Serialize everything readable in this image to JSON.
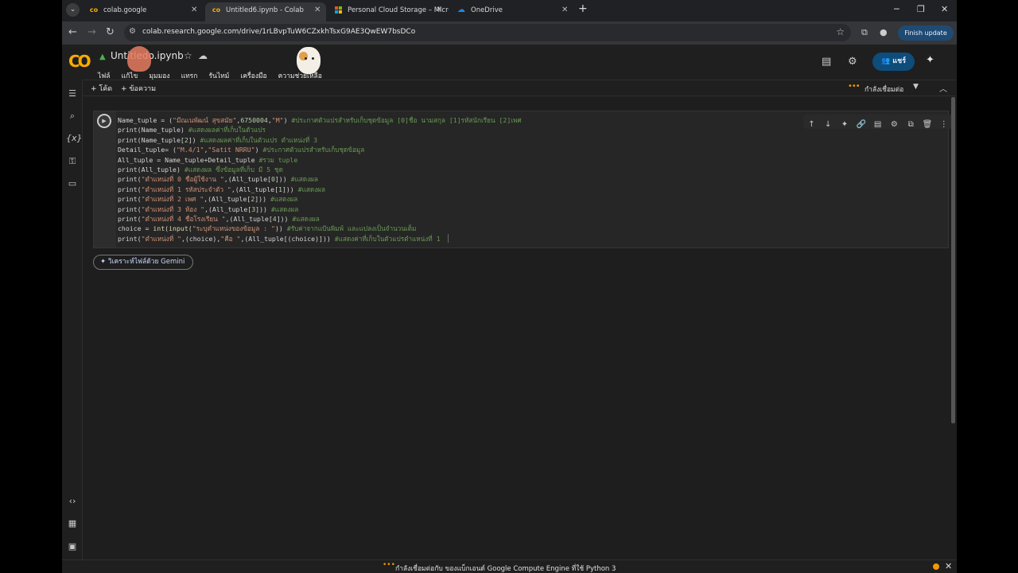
{
  "browser": {
    "tabs": [
      {
        "title": "colab.google",
        "icon": "colab-logo-icon"
      },
      {
        "title": "Untitled6.ipynb - Colab",
        "icon": "colab-logo-icon"
      },
      {
        "title": "Personal Cloud Storage – Micro",
        "icon": "microsoft-logo-icon"
      },
      {
        "title": "OneDrive",
        "icon": "onedrive-cloud-icon"
      }
    ],
    "active_tab": 1,
    "url": "colab.research.google.com/drive/1rLBvpTuW6CZxkhTsxG9AE3QwEW7bsDCo",
    "finish_update_label": "Finish update"
  },
  "colab": {
    "notebook_title": "Untitledo.ipynb",
    "menu": [
      "ไฟล์",
      "แก้ไข",
      "มุมมอง",
      "แทรก",
      "รันไทม์",
      "เครื่องมือ",
      "ความช่วยเหลือ"
    ],
    "share_label": "แชร์",
    "add_code_label": "+ โค้ด",
    "add_text_label": "+ ข้อความ",
    "connection_status": "กำลังเชื่อมต่อ",
    "gemini_analyze_label": "วิเคราะห์ไฟล์ด้วย Gemini",
    "status_bar_text": "กำลังเชื่อมต่อกับ ของแบ็กเอนด์ Google Compute Engine ที่ใช้ Python 3",
    "accent_color": "#f9ab00"
  },
  "code_lines": [
    [
      {
        "t": "Name_tuple = (",
        "c": "kw"
      },
      {
        "t": "\"มีณเนพัฒน์ สุขสมัย\"",
        "c": "str"
      },
      {
        "t": ",",
        "c": "kw"
      },
      {
        "t": "6750004",
        "c": "num"
      },
      {
        "t": ",",
        "c": "kw"
      },
      {
        "t": "\"M\"",
        "c": "str"
      },
      {
        "t": ") ",
        "c": "kw"
      },
      {
        "t": "#ประกาศตัวแปรสำหรับเก็บชุดข้อมูล [0]ชื่อ นามสกุล [1]รหัสนักเรียน [2]เพศ",
        "c": "com"
      }
    ],
    [
      {
        "t": "print",
        "c": "kw"
      },
      {
        "t": "(Name_tuple) ",
        "c": "kw"
      },
      {
        "t": "#แสดงผลค่าที่เก็บในตัวแปร",
        "c": "com"
      }
    ],
    [
      {
        "t": "print",
        "c": "kw"
      },
      {
        "t": "(Name_tuple[",
        "c": "kw"
      },
      {
        "t": "2",
        "c": "num"
      },
      {
        "t": "]) ",
        "c": "kw"
      },
      {
        "t": "#แสดงผลค่าที่เก็บในตัวแปร ตำแหน่งที่ 3",
        "c": "com"
      }
    ],
    [
      {
        "t": "Detail_tuple= (",
        "c": "kw"
      },
      {
        "t": "\"M.4/1\"",
        "c": "str"
      },
      {
        "t": ",",
        "c": "kw"
      },
      {
        "t": "\"Satit NRRU\"",
        "c": "str"
      },
      {
        "t": ") ",
        "c": "kw"
      },
      {
        "t": "#ประกาศตัวแปรสำหรับเก็บชุดข้อมูล",
        "c": "com"
      }
    ],
    [
      {
        "t": "All_tuple = Name_tuple+Detail_tuple ",
        "c": "kw"
      },
      {
        "t": "#รวม tuple",
        "c": "com"
      }
    ],
    [
      {
        "t": "print",
        "c": "kw"
      },
      {
        "t": "(All_tuple) ",
        "c": "kw"
      },
      {
        "t": "#แสดงผล ซึ่งข้อมูลที่เก็บ มี 5 ชุด",
        "c": "com"
      }
    ],
    [
      {
        "t": "print",
        "c": "kw"
      },
      {
        "t": "(",
        "c": "kw"
      },
      {
        "t": "\"ตำแหน่งที่ 0 ชื่อผู้ใช้งาน \"",
        "c": "str"
      },
      {
        "t": ",(All_tuple[",
        "c": "kw"
      },
      {
        "t": "0",
        "c": "num"
      },
      {
        "t": "])) ",
        "c": "kw"
      },
      {
        "t": "#แสดงผล",
        "c": "com"
      }
    ],
    [
      {
        "t": "print",
        "c": "kw"
      },
      {
        "t": "(",
        "c": "kw"
      },
      {
        "t": "\"ตำแหน่งที่ 1 รหัสประจำตัว \"",
        "c": "str"
      },
      {
        "t": ",(All_tuple[",
        "c": "kw"
      },
      {
        "t": "1",
        "c": "num"
      },
      {
        "t": "])) ",
        "c": "kw"
      },
      {
        "t": "#แสดงผล",
        "c": "com"
      }
    ],
    [
      {
        "t": "print",
        "c": "kw"
      },
      {
        "t": "(",
        "c": "kw"
      },
      {
        "t": "\"ตำแหน่งที่ 2 เพศ \"",
        "c": "str"
      },
      {
        "t": ",(All_tuple[",
        "c": "kw"
      },
      {
        "t": "2",
        "c": "num"
      },
      {
        "t": "])) ",
        "c": "kw"
      },
      {
        "t": "#แสดงผล",
        "c": "com"
      }
    ],
    [
      {
        "t": "print",
        "c": "kw"
      },
      {
        "t": "(",
        "c": "kw"
      },
      {
        "t": "\"ตำแหน่งที่ 3 ห้อง \"",
        "c": "str"
      },
      {
        "t": ",(All_tuple[",
        "c": "kw"
      },
      {
        "t": "3",
        "c": "num"
      },
      {
        "t": "])) ",
        "c": "kw"
      },
      {
        "t": "#แสดงผล",
        "c": "com"
      }
    ],
    [
      {
        "t": "print",
        "c": "kw"
      },
      {
        "t": "(",
        "c": "kw"
      },
      {
        "t": "\"ตำแหน่งที่ 4 ชื่อโรงเรียน \"",
        "c": "str"
      },
      {
        "t": ",(All_tuple[",
        "c": "kw"
      },
      {
        "t": "4",
        "c": "num"
      },
      {
        "t": "])) ",
        "c": "kw"
      },
      {
        "t": "#แสดงผล",
        "c": "com"
      }
    ],
    [
      {
        "t": "choice = ",
        "c": "kw"
      },
      {
        "t": "int",
        "c": "fn"
      },
      {
        "t": "(",
        "c": "kw"
      },
      {
        "t": "input",
        "c": "fn"
      },
      {
        "t": "(",
        "c": "kw"
      },
      {
        "t": "\"ระบุตำแหน่งของข้อมูล : \"",
        "c": "str"
      },
      {
        "t": ")) ",
        "c": "kw"
      },
      {
        "t": "#รับค่าจากแป้นพิมพ์ และแปลงเป็นจำนวนเต็ม",
        "c": "com"
      }
    ],
    [
      {
        "t": "print",
        "c": "kw"
      },
      {
        "t": "(",
        "c": "kw"
      },
      {
        "t": "\"ตำแหน่งที่ \"",
        "c": "str"
      },
      {
        "t": ",(choice),",
        "c": "kw"
      },
      {
        "t": "\"คือ \"",
        "c": "str"
      },
      {
        "t": ",(All_tuple[(choice)])) ",
        "c": "kw"
      },
      {
        "t": "#แสดงค่าที่เก็บในตัวแปรตำแหน่งที่ 1",
        "c": "com"
      }
    ]
  ]
}
